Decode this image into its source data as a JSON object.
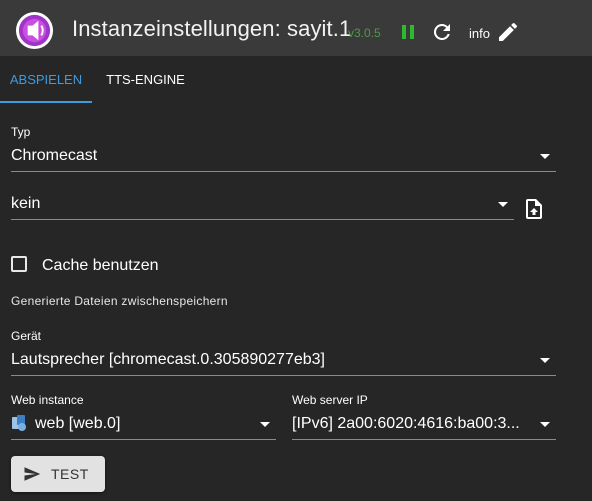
{
  "header": {
    "title": "Instanzeinstellungen: sayit.1",
    "version": "v3.0.5",
    "info_label": "info",
    "icons": [
      "app-logo",
      "pause-icon",
      "reload-icon",
      "edit-icon"
    ],
    "accent_color": "#3d9be0",
    "version_color": "#4c9a4c",
    "pause_color": "#2eb82e"
  },
  "tabs": [
    {
      "label": "ABSPIELEN",
      "active": true
    },
    {
      "label": "TTS-ENGINE",
      "active": false
    }
  ],
  "form": {
    "type": {
      "label": "Typ",
      "value": "Chromecast"
    },
    "announce": {
      "value": "kein"
    },
    "cache": {
      "label": "Cache benutzen",
      "checked": false,
      "helper": "Generierte Dateien zwischenspeichern"
    },
    "device": {
      "label": "Gerät",
      "value": "Lautsprecher [chromecast.0.305890277eb3]"
    },
    "web_instance": {
      "label": "Web instance",
      "value": "web [web.0]"
    },
    "web_server_ip": {
      "label": "Web server IP",
      "value": "[IPv6] 2a00:6020:4616:ba00:3..."
    }
  },
  "actions": {
    "test_label": "TEST"
  }
}
